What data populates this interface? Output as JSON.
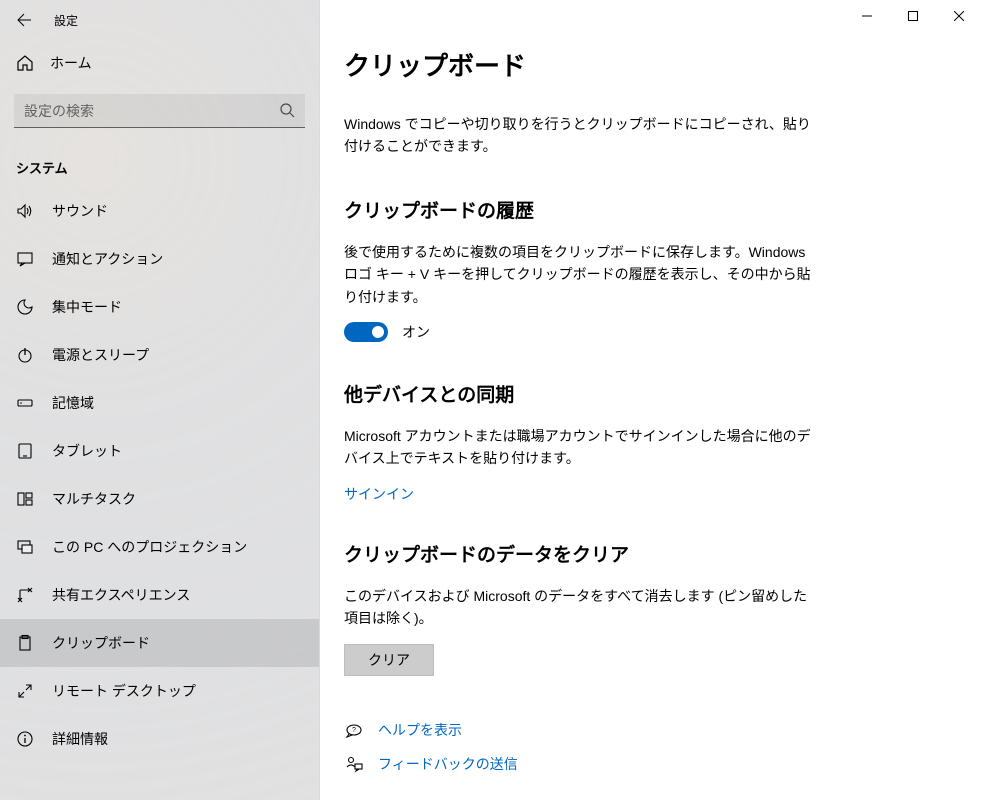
{
  "app_title": "設定",
  "home_label": "ホーム",
  "search_placeholder": "設定の検索",
  "group_label": "システム",
  "sidebar": {
    "items": [
      {
        "label": "サウンド"
      },
      {
        "label": "通知とアクション"
      },
      {
        "label": "集中モード"
      },
      {
        "label": "電源とスリープ"
      },
      {
        "label": "記憶域"
      },
      {
        "label": "タブレット"
      },
      {
        "label": "マルチタスク"
      },
      {
        "label": "この PC へのプロジェクション"
      },
      {
        "label": "共有エクスペリエンス"
      },
      {
        "label": "クリップボード"
      },
      {
        "label": "リモート デスクトップ"
      },
      {
        "label": "詳細情報"
      }
    ]
  },
  "main": {
    "title": "クリップボード",
    "intro": "Windows でコピーや切り取りを行うとクリップボードにコピーされ、貼り付けることができます。",
    "history": {
      "title": "クリップボードの履歴",
      "desc": "後で使用するために複数の項目をクリップボードに保存します。Windows ロゴ キー + V キーを押してクリップボードの履歴を表示し、その中から貼り付けます。",
      "toggle_state": "オン"
    },
    "sync": {
      "title": "他デバイスとの同期",
      "desc": "Microsoft アカウントまたは職場アカウントでサインインした場合に他のデバイス上でテキストを貼り付けます。",
      "link": "サインイン"
    },
    "clear": {
      "title": "クリップボードのデータをクリア",
      "desc": "このデバイスおよび Microsoft のデータをすべて消去します (ピン留めした項目は除く)。",
      "button": "クリア"
    },
    "support": {
      "help": "ヘルプを表示",
      "feedback": "フィードバックの送信"
    }
  }
}
